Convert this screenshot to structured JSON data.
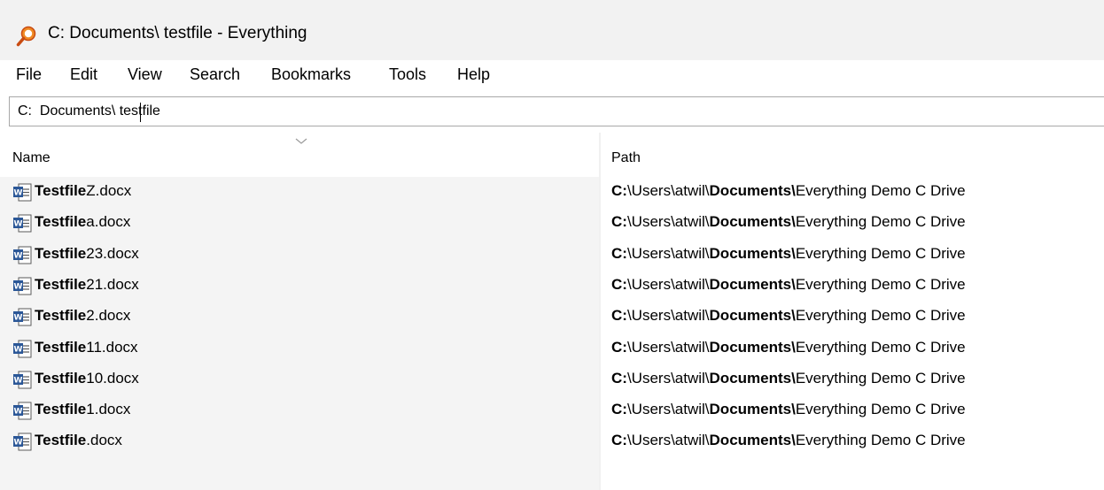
{
  "window": {
    "title": "C:  Documents\\ testfile - Everything",
    "icon": "search-magnifier-icon"
  },
  "menu": {
    "items": [
      "File",
      "Edit",
      "View",
      "Search",
      "Bookmarks",
      "Tools",
      "Help"
    ]
  },
  "search": {
    "value": "C:  Documents\\ testfile"
  },
  "columns": {
    "name": "Name",
    "path": "Path"
  },
  "results": [
    {
      "name_match": "Testfile",
      "name_rest": "Z.docx",
      "path_drive": "C:",
      "path_mid": "\\Users\\atwil\\",
      "path_match": "Documents\\",
      "path_rest": "Everything Demo C Drive",
      "icon": "word-document-icon"
    },
    {
      "name_match": "Testfile",
      "name_rest": "a.docx",
      "path_drive": "C:",
      "path_mid": "\\Users\\atwil\\",
      "path_match": "Documents\\",
      "path_rest": "Everything Demo C Drive",
      "icon": "word-document-icon"
    },
    {
      "name_match": "Testfile",
      "name_rest": "23.docx",
      "path_drive": "C:",
      "path_mid": "\\Users\\atwil\\",
      "path_match": "Documents\\",
      "path_rest": "Everything Demo C Drive",
      "icon": "word-document-icon"
    },
    {
      "name_match": "Testfile",
      "name_rest": "21.docx",
      "path_drive": "C:",
      "path_mid": "\\Users\\atwil\\",
      "path_match": "Documents\\",
      "path_rest": "Everything Demo C Drive",
      "icon": "word-document-icon"
    },
    {
      "name_match": "Testfile",
      "name_rest": "2.docx",
      "path_drive": "C:",
      "path_mid": "\\Users\\atwil\\",
      "path_match": "Documents\\",
      "path_rest": "Everything Demo C Drive",
      "icon": "word-document-icon"
    },
    {
      "name_match": "Testfile",
      "name_rest": "11.docx",
      "path_drive": "C:",
      "path_mid": "\\Users\\atwil\\",
      "path_match": "Documents\\",
      "path_rest": "Everything Demo C Drive",
      "icon": "word-document-icon"
    },
    {
      "name_match": "Testfile",
      "name_rest": "10.docx",
      "path_drive": "C:",
      "path_mid": "\\Users\\atwil\\",
      "path_match": "Documents\\",
      "path_rest": "Everything Demo C Drive",
      "icon": "word-document-icon"
    },
    {
      "name_match": "Testfile",
      "name_rest": "1.docx",
      "path_drive": "C:",
      "path_mid": "\\Users\\atwil\\",
      "path_match": "Documents\\",
      "path_rest": "Everything Demo C Drive",
      "icon": "word-document-icon"
    },
    {
      "name_match": "Testfile",
      "name_rest": ".docx",
      "path_drive": "C:",
      "path_mid": "\\Users\\atwil\\",
      "path_match": "Documents\\",
      "path_rest": "Everything Demo C Drive",
      "icon": "word-document-icon"
    }
  ],
  "colors": {
    "app_icon": "#e8641b",
    "word_blue": "#2b5797",
    "titlebar_bg": "#f2f2f2",
    "name_column_bg": "#f4f4f4"
  }
}
